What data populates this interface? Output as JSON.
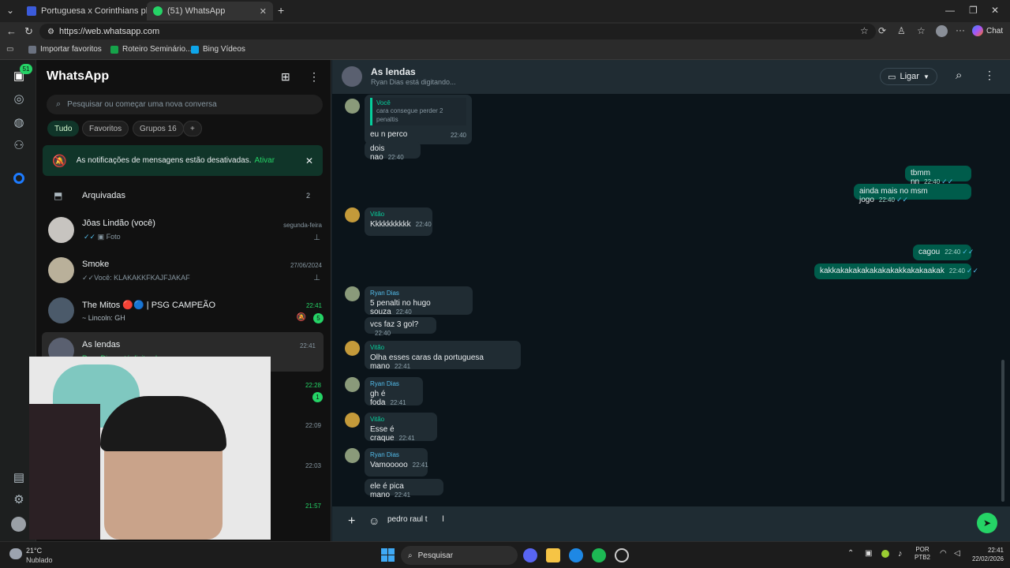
{
  "browser": {
    "tabs": [
      {
        "title": "Portuguesa x Corinthians placar ao",
        "active": false
      },
      {
        "title": "(51) WhatsApp",
        "active": true
      }
    ],
    "url": "https://web.whatsapp.com",
    "chat_button": "Chat",
    "favorites": [
      "Importar favoritos",
      "Roteiro Seminário...",
      "Bing Vídeos"
    ]
  },
  "rail": {
    "badge": "51"
  },
  "sidebar": {
    "title": "WhatsApp",
    "search_placeholder": "Pesquisar ou começar uma nova conversa",
    "filters": [
      "Tudo",
      "Favoritos",
      "Grupos 16"
    ],
    "notice_text": "As notificações de mensagens estão desativadas.",
    "notice_link": "Ativar",
    "archived_label": "Arquivadas",
    "archived_count": "2",
    "chats": [
      {
        "name": "Jôas Lindão (você)",
        "preview": "Foto",
        "time": "segunda-feira"
      },
      {
        "name": "Smoke",
        "preview": "Você: KLAKAKKFKAJFJAKAF",
        "time": "27/06/2024"
      },
      {
        "name": "The Mitos 🔴🔵 | PSG CAMPEÃO",
        "preview": "~ Lincoln: GH",
        "time": "22:41",
        "unread": "5"
      },
      {
        "name": "As lendas",
        "preview": "Ryan Dias está digitando...",
        "time": "22:41"
      }
    ],
    "hidden_times": [
      "22:28",
      "22:09",
      "22:03",
      "21:57"
    ],
    "hidden_unread": "1"
  },
  "chat": {
    "name": "As lendas",
    "status": "Ryan Dias está digitando...",
    "call_label": "Ligar",
    "messages": [
      {
        "dir": "in",
        "sender": "Você",
        "reply": "cara consegue perder 2 penaltis",
        "text": "eu n perco",
        "time": "22:40"
      },
      {
        "dir": "in",
        "text": "dois nao",
        "time": "22:40"
      },
      {
        "dir": "out",
        "text": "tbmm nn",
        "time": "22:40"
      },
      {
        "dir": "out",
        "text": "ainda mais no msm jogo",
        "time": "22:40"
      },
      {
        "dir": "in",
        "sender": "Vitão",
        "text": "Kkkkkkkkkk",
        "time": "22:40"
      },
      {
        "dir": "out",
        "text": "cagou",
        "time": "22:40"
      },
      {
        "dir": "out",
        "text": "kakkakakakakakakakakkakakaakak",
        "time": "22:40"
      },
      {
        "dir": "in",
        "sender": "Ryan Dias",
        "text": "5 penalti no hugo souza",
        "time": "22:40"
      },
      {
        "dir": "in",
        "text": "vcs faz 3 gol?",
        "time": "22:40"
      },
      {
        "dir": "in",
        "sender": "Vitão",
        "text": "Olha esses caras da portuguesa mano",
        "time": "22:41"
      },
      {
        "dir": "in",
        "sender": "Ryan Dias",
        "text": "gh é foda",
        "time": "22:41"
      },
      {
        "dir": "in",
        "sender": "Vitão",
        "text": "Esse é craque",
        "time": "22:41"
      },
      {
        "dir": "in",
        "sender": "Ryan Dias",
        "text": "Vamooooo",
        "time": "22:41"
      },
      {
        "dir": "in",
        "text": "ele é pica mano",
        "time": "22:41"
      }
    ],
    "compose_value": "pedro raul t"
  },
  "taskbar": {
    "temp": "21°C",
    "weather": "Nublado",
    "search": "Pesquisar",
    "lang1": "POR",
    "lang2": "PTB2",
    "time": "22:41",
    "date": "22/02/2026"
  },
  "colors": {
    "accent": "#25d366",
    "bg": "#0b141a",
    "out": "#005c4b",
    "in": "#202c33"
  }
}
